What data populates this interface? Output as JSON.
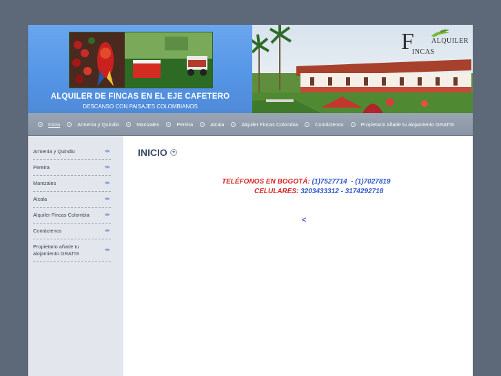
{
  "header": {
    "title": "ALQUILER DE FINCAS EN EL EJE CAFETERO",
    "subtitle": "DESCANSO CON PAISAJES COLOMBIANOS",
    "logo": {
      "letter": "F",
      "word1": "ALQUILER",
      "word2": "INCAS"
    }
  },
  "nav": {
    "items": [
      {
        "label": "Inicio"
      },
      {
        "label": "Armenia y Quindio"
      },
      {
        "label": "Manizales"
      },
      {
        "label": "Pereira"
      },
      {
        "label": "Alcala"
      },
      {
        "label": "Alquiler Fincas Colombia"
      },
      {
        "label": "Contáctenos"
      },
      {
        "label": "Propietario añade tu alojamiento GRATIS"
      }
    ]
  },
  "sidebar": {
    "arrow_glyph": "»»",
    "items": [
      {
        "label": "Armenia y Quindio"
      },
      {
        "label": "Pereira"
      },
      {
        "label": "Manizales"
      },
      {
        "label": "Alcala"
      },
      {
        "label": "Alquiler Fincas Colombia"
      },
      {
        "label": "Contáctenos"
      },
      {
        "label": "Propietario añade tu alojamiento GRATIS"
      }
    ]
  },
  "main": {
    "title": "INICIO",
    "phones_label": "TELÉFONOS EN BOGOTÁ: ",
    "phones_value": "(1)7527714  - (1)7027819",
    "mobile_label": "CELULARES: ",
    "mobile_value": "3203433312 - 3174292718",
    "lt_glyph": "<"
  },
  "colors": {
    "background": "#5d6878",
    "header_blue": "#5596e6",
    "navbar": "#8f9aab",
    "sidebar": "#e3e6ec",
    "title": "#3c4a6a",
    "phone_label": "#d42222",
    "phone_value": "#2f58c8"
  }
}
